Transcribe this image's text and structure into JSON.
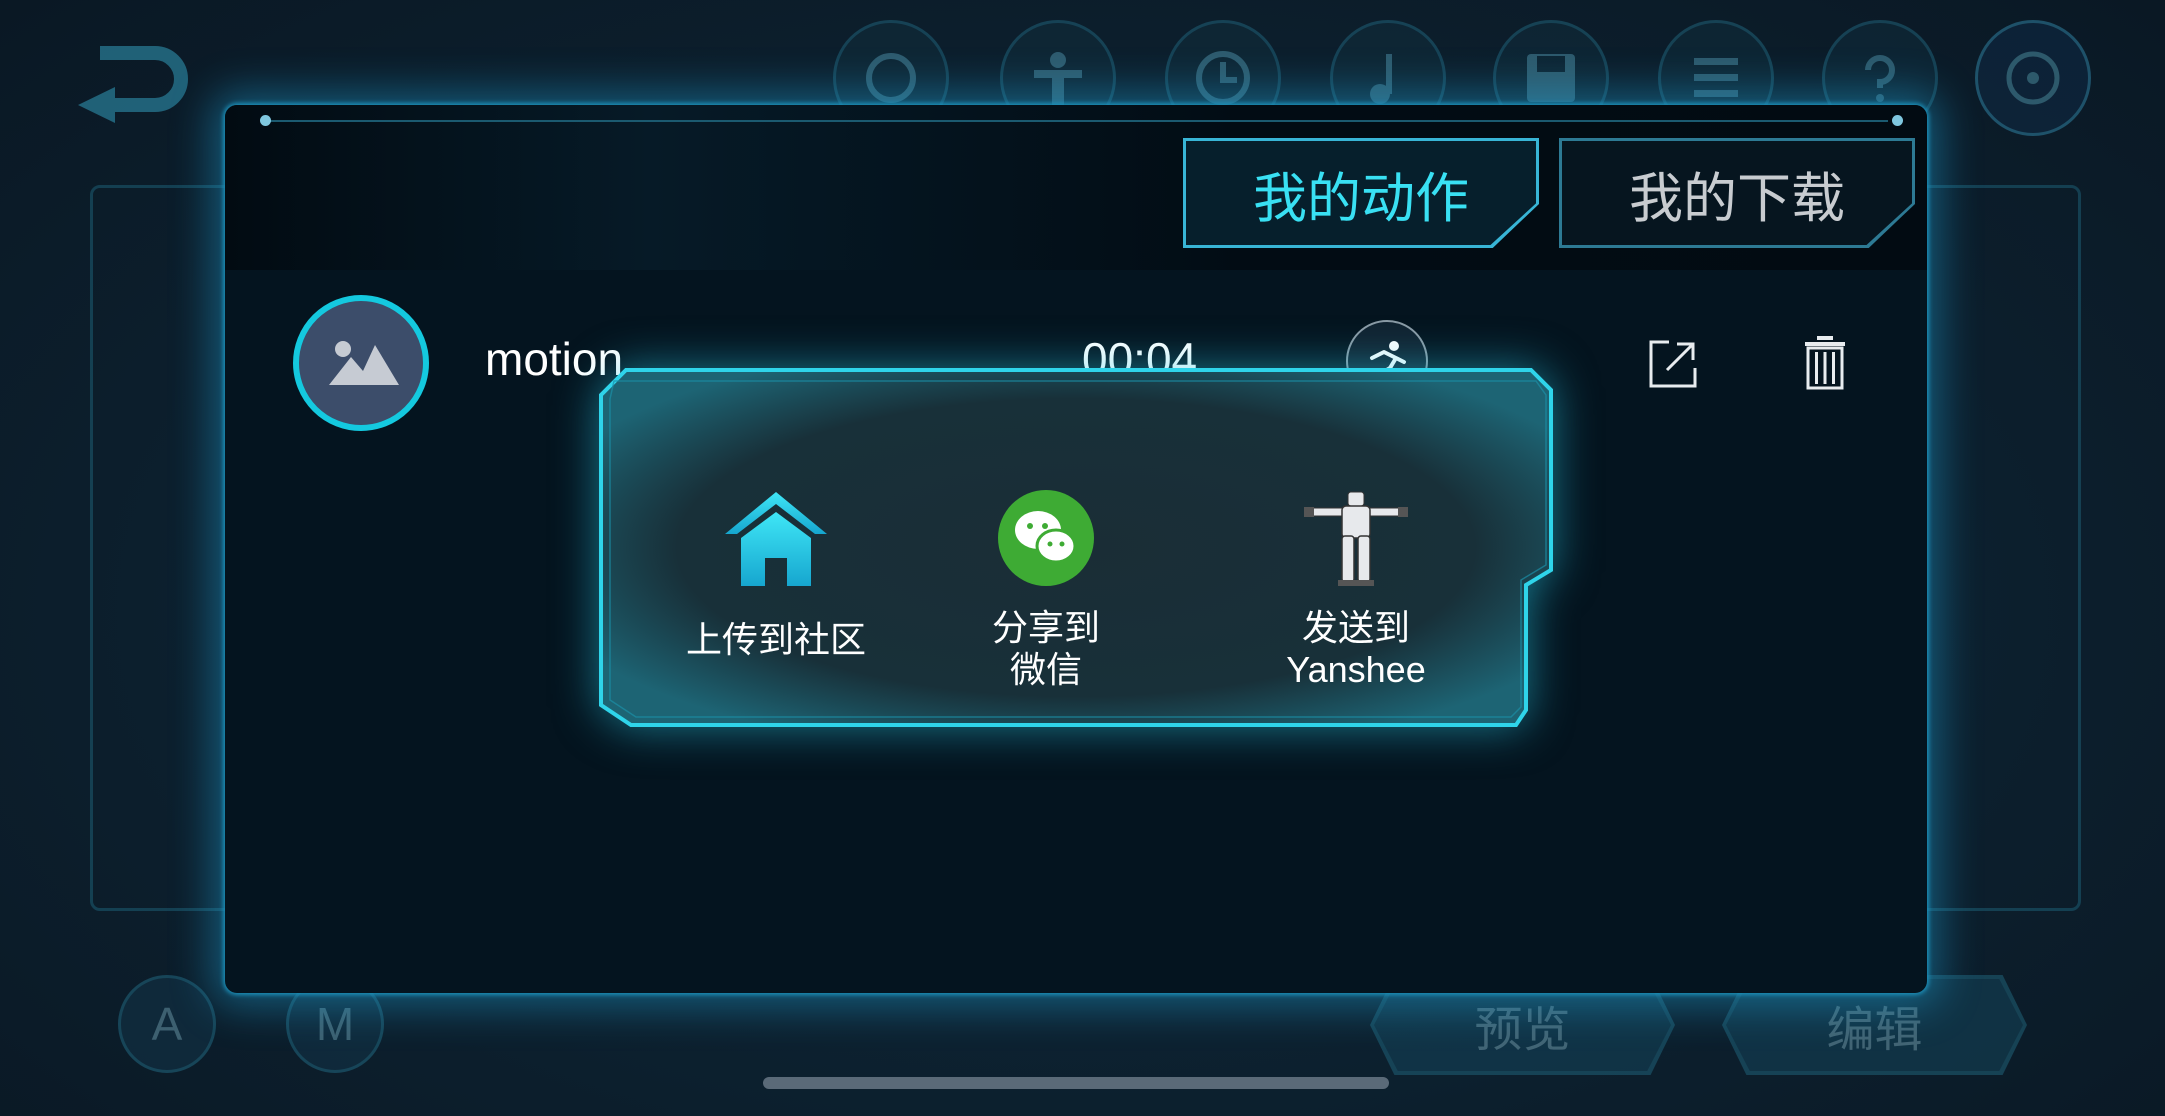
{
  "tabs": [
    {
      "label": "我的动作",
      "active": true
    },
    {
      "label": "我的下载",
      "active": false
    }
  ],
  "motion_row": {
    "name": "motion",
    "duration": "00:04"
  },
  "share_menu": {
    "items": [
      {
        "label_line1": "上传到社区",
        "label_line2": "",
        "icon": "home-icon"
      },
      {
        "label_line1": "分享到",
        "label_line2": "微信",
        "icon": "wechat-icon"
      },
      {
        "label_line1": "发送到",
        "label_line2": "Yanshee",
        "icon": "robot-icon"
      }
    ]
  },
  "background": {
    "mode_buttons": [
      "A",
      "M"
    ],
    "bottom_buttons": [
      "预览",
      "编辑"
    ]
  },
  "colors": {
    "accent": "#39e0f3",
    "border": "#14c9df",
    "wechat": "#3eab34",
    "dialog_bg": "#04141f"
  }
}
